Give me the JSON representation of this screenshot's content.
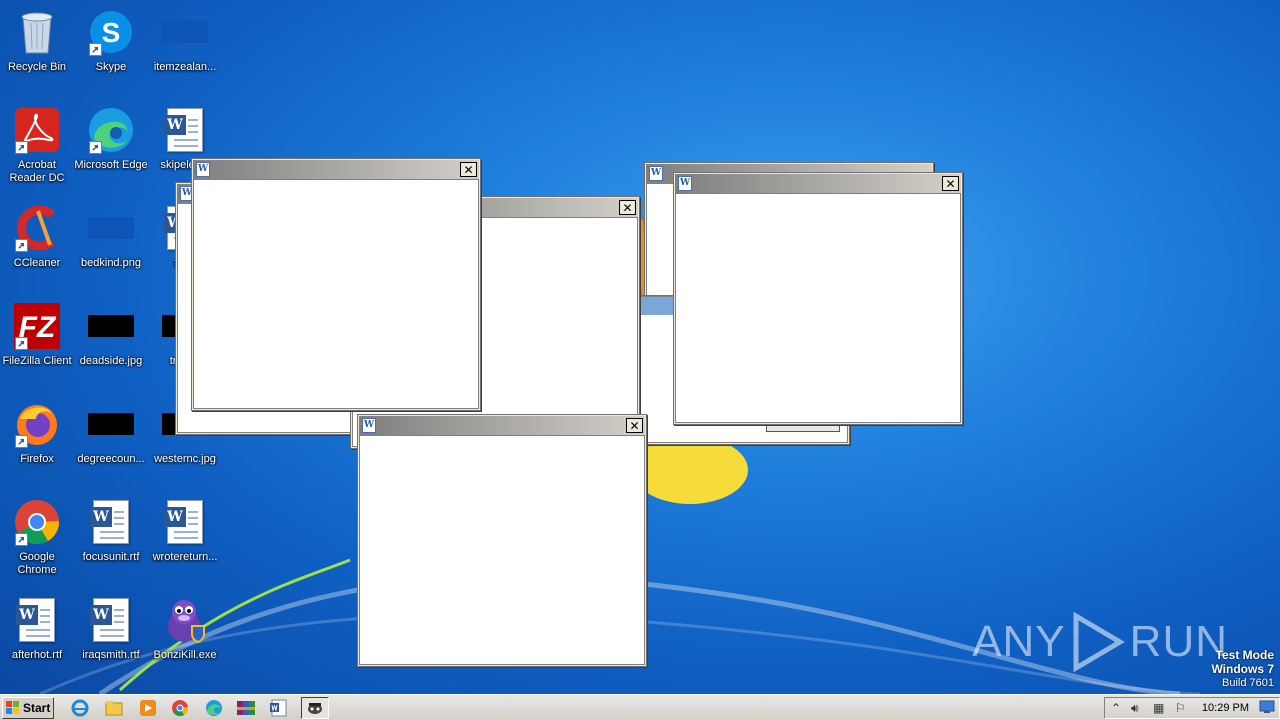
{
  "desktop": {
    "icons": [
      {
        "label": "Recycle Bin",
        "icon": "recycle-bin-icon"
      },
      {
        "label": "Skype",
        "icon": "skype-icon"
      },
      {
        "label": "itemzealan...",
        "icon": "image-file-icon"
      },
      {
        "label": "Acrobat Reader DC",
        "icon": "acrobat-icon"
      },
      {
        "label": "Microsoft Edge",
        "icon": "edge-icon"
      },
      {
        "label": "skipelec...",
        "icon": "word-document-icon"
      },
      {
        "label": "CCleaner",
        "icon": "ccleaner-icon"
      },
      {
        "label": "bedkind.png",
        "icon": "image-file-icon"
      },
      {
        "label": "tot...",
        "icon": "word-document-icon"
      },
      {
        "label": "FileZilla Client",
        "icon": "filezilla-icon"
      },
      {
        "label": "deadside.jpg",
        "icon": "image-file-icon"
      },
      {
        "label": "tradi...",
        "icon": "image-file-icon"
      },
      {
        "label": "Firefox",
        "icon": "firefox-icon"
      },
      {
        "label": "degreecoun...",
        "icon": "image-file-icon"
      },
      {
        "label": "westernc.jpg",
        "icon": "image-file-icon"
      },
      {
        "label": "Google Chrome",
        "icon": "chrome-icon"
      },
      {
        "label": "focusunit.rtf",
        "icon": "word-document-icon"
      },
      {
        "label": "wrotereturn...",
        "icon": "word-document-icon"
      },
      {
        "label": "afterhot.rtf",
        "icon": "word-document-icon"
      },
      {
        "label": "iraqsmith.rtf",
        "icon": "word-document-icon"
      },
      {
        "label": "BonziKill.exe",
        "icon": "bonzi-icon"
      }
    ]
  },
  "windows": {
    "close_glyph": "✕",
    "app_glyph": "W"
  },
  "taskbar": {
    "start_label": "Start",
    "clock": "10:29 PM",
    "apps": [
      "ie-icon",
      "explorer-icon",
      "media-player-icon",
      "chrome-icon",
      "edge-icon",
      "winrar-icon",
      "word-icon",
      "bonzi-icon"
    ]
  },
  "watermark": {
    "left": "ANY",
    "right": "RUN"
  },
  "system": {
    "mode": "Test Mode",
    "os": "Windows 7",
    "build": "Build 7601"
  },
  "colors": {
    "desktop_blue": "#1f7fdc",
    "title_gradient_start": "#7f7f7f",
    "title_gradient_end": "#d4d0c8"
  }
}
